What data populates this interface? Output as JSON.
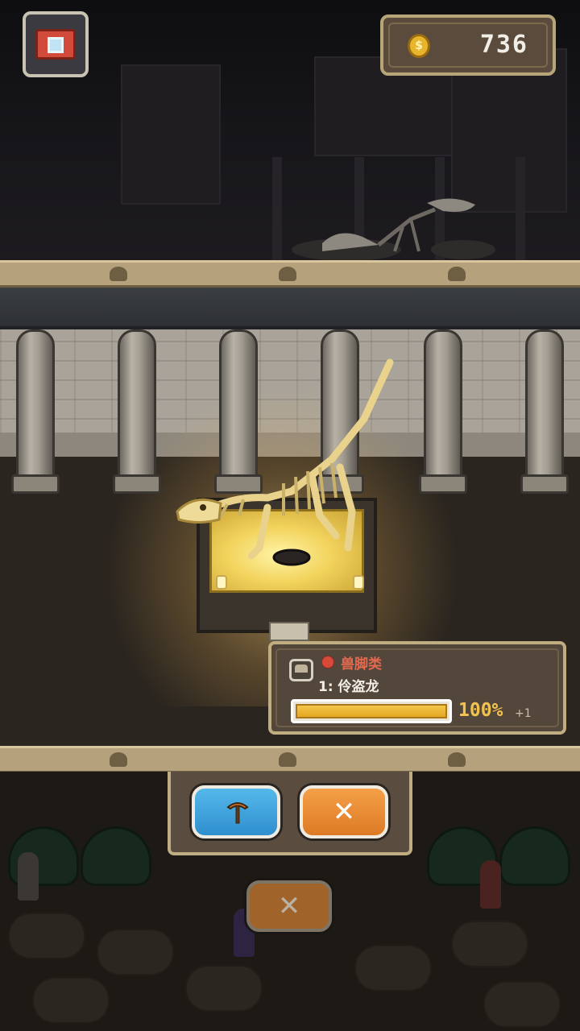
{
  "hud": {
    "coins": "736",
    "coin_icon": "coin-icon",
    "camera_icon": "camera-icon"
  },
  "exhibit": {
    "category": "兽脚类",
    "category_color": "#d74a3a",
    "fossil_name": "1: 伶盗龙",
    "completion_percent": 100,
    "completion_label": "100%",
    "bonus_label": "+1"
  },
  "actions": {
    "dig_icon": "pickaxe-icon",
    "dig_color": "#3fa6e0",
    "close_icon": "close-icon",
    "close_color": "#e8892f",
    "back_close_icon": "close-icon"
  }
}
